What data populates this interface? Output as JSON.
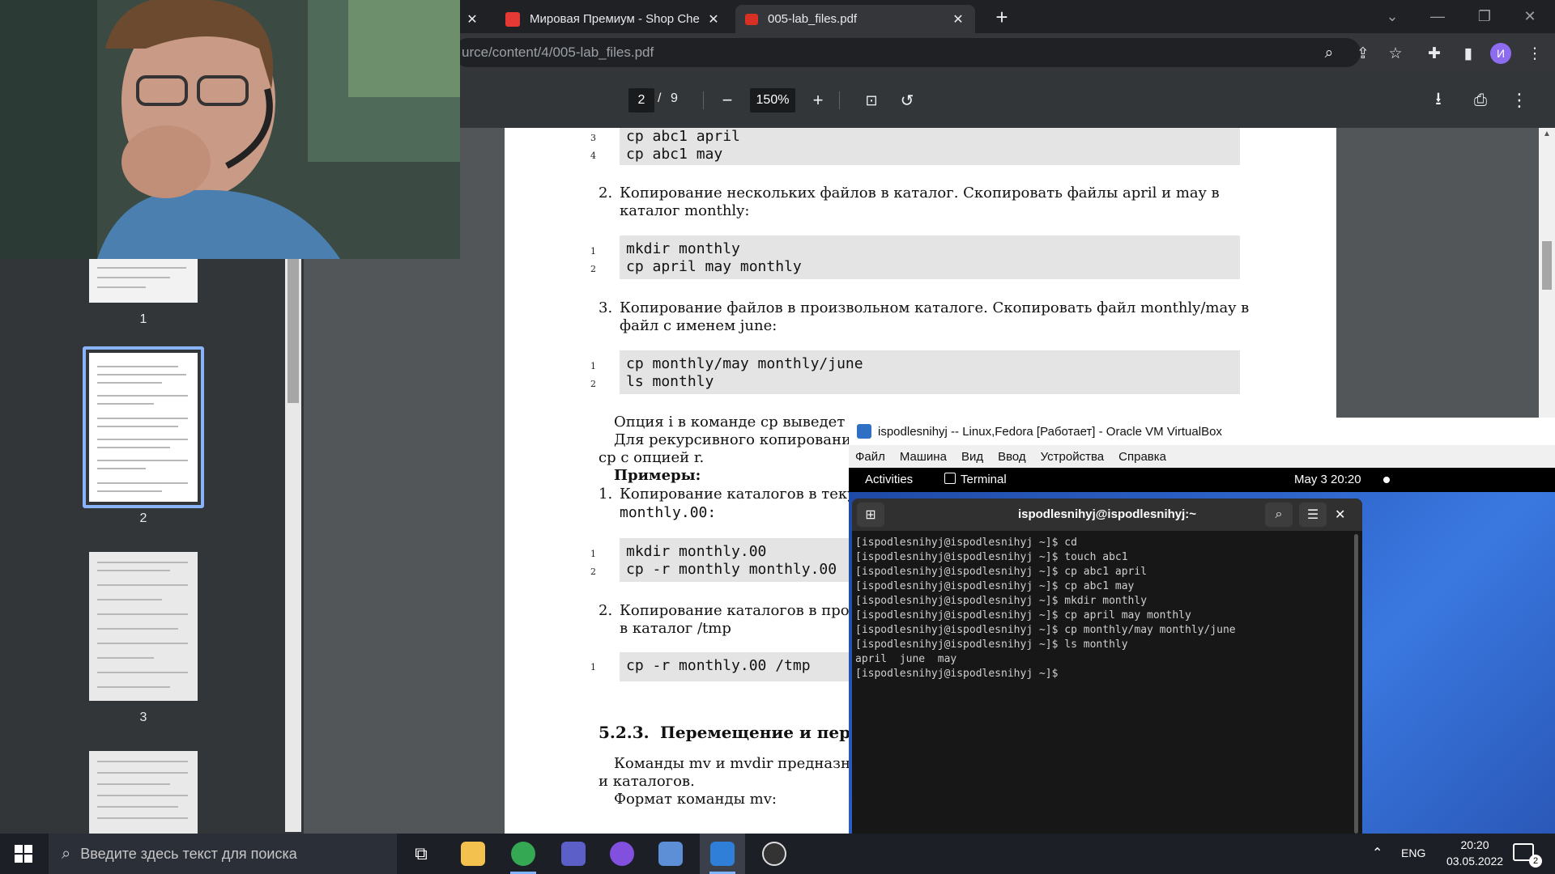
{
  "browser": {
    "tabs": [
      {
        "title": "",
        "active": false
      },
      {
        "title": "Мировая Премиум - Shop Chea",
        "active": false
      },
      {
        "title": "005-lab_files.pdf",
        "active": true
      }
    ],
    "new_tab": "+",
    "url": "urce/content/4/005-lab_files.pdf",
    "profile_initial": "И"
  },
  "pdf": {
    "page_current": "2",
    "page_sep": "/",
    "page_total": "9",
    "zoom": "150%",
    "thumbnails": [
      {
        "label": "1"
      },
      {
        "label": "2"
      },
      {
        "label": "3"
      }
    ],
    "content": {
      "block0": {
        "lines": [
          {
            "n": "3",
            "code": "cp abc1 april"
          },
          {
            "n": "4",
            "code": "cp abc1 may"
          }
        ]
      },
      "item2_num": "2.",
      "item2_text": "Копирование нескольких файлов в каталог. Скопировать файлы april и may в каталог monthly:",
      "block1": {
        "lines": [
          {
            "n": "1",
            "code": "mkdir monthly"
          },
          {
            "n": "2",
            "code": "cp april may monthly"
          }
        ]
      },
      "item3_num": "3.",
      "item3_text": "Копирование файлов в произвольном каталоге. Скопировать файл monthly/may в файл с именем june:",
      "block2": {
        "lines": [
          {
            "n": "1",
            "code": "cp monthly/may monthly/june"
          },
          {
            "n": "2",
            "code": "ls monthly"
          }
        ]
      },
      "option_line1": "Опция i в команде cp выведет н",
      "option_line2": "Для рекурсивного копирования",
      "option_line3": "cp с опцией r.",
      "examples_heading": "Примеры:",
      "ex1_num": "1.",
      "ex1_text1": "Копирование каталогов в текущ",
      "ex1_text2": "monthly.00:",
      "block3": {
        "lines": [
          {
            "n": "1",
            "code": "mkdir monthly.00"
          },
          {
            "n": "2",
            "code": "cp -r monthly monthly.00"
          }
        ]
      },
      "ex2_num": "2.",
      "ex2_text1": "Копирование каталогов в прои",
      "ex2_text2": "в каталог /tmp",
      "block4": {
        "lines": [
          {
            "n": "1",
            "code": "cp -r  monthly.00 /tmp"
          }
        ]
      },
      "section_num": "5.2.3.",
      "section_title": "Перемещение и пере",
      "mv_line1": "Команды mv и mvdir предназна",
      "mv_line2": "и каталогов.",
      "mv_line3": "Формат команды mv:"
    }
  },
  "vbox": {
    "title": "ispodlesnihyj -- Linux,Fedora [Работает] - Oracle VM VirtualBox",
    "menu": [
      "Файл",
      "Машина",
      "Вид",
      "Ввод",
      "Устройства",
      "Справка"
    ],
    "gnome": {
      "activities": "Activities",
      "app": "Terminal",
      "clock": "May 3  20:20"
    },
    "terminal": {
      "title": "ispodlesnihyj@ispodlesnihyj:~",
      "output": "[ispodlesnihyj@ispodlesnihyj ~]$ cd\n[ispodlesnihyj@ispodlesnihyj ~]$ touch abc1\n[ispodlesnihyj@ispodlesnihyj ~]$ cp abc1 april\n[ispodlesnihyj@ispodlesnihyj ~]$ cp abc1 may\n[ispodlesnihyj@ispodlesnihyj ~]$ mkdir monthly\n[ispodlesnihyj@ispodlesnihyj ~]$ cp april may monthly\n[ispodlesnihyj@ispodlesnihyj ~]$ cp monthly/may monthly/june\n[ispodlesnihyj@ispodlesnihyj ~]$ ls monthly\napril  june  may\n[ispodlesnihyj@ispodlesnihyj ~]$ "
    }
  },
  "taskbar": {
    "search_placeholder": "Введите здесь текст для поиска",
    "lang": "ENG",
    "time": "20:20",
    "date": "03.05.2022",
    "notif_count": "2"
  }
}
